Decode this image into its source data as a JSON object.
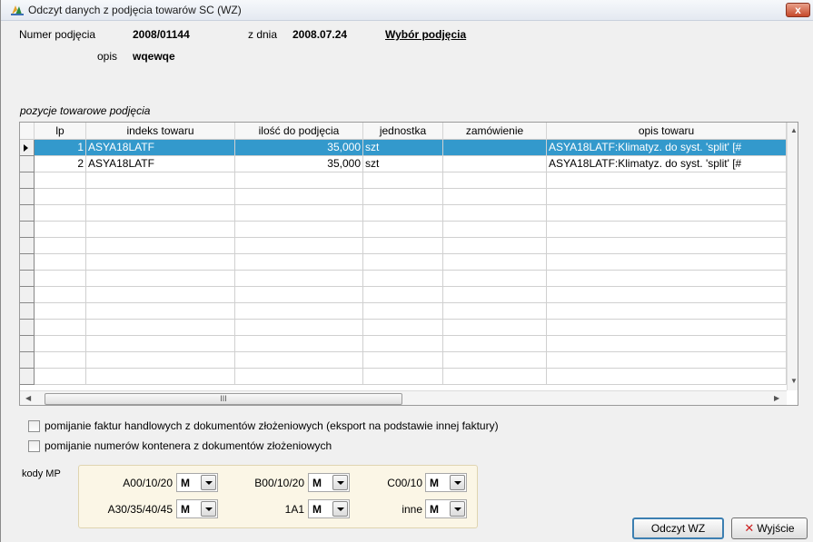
{
  "window": {
    "title": "Odczyt danych z podjęcia towarów SC (WZ)",
    "close_label": "x"
  },
  "header": {
    "numer_label": "Numer podjęcia",
    "numer_value": "2008/01144",
    "data_label": "z dnia",
    "data_value": "2008.07.24",
    "wybor_link": "Wybór podjęcia",
    "opis_label": "opis",
    "opis_value": "wqewqe"
  },
  "grid": {
    "section_label": "pozycje towarowe podjęcia",
    "columns": [
      "lp",
      "indeks towaru",
      "ilość do podjęcia",
      "jednostka",
      "zamówienie",
      "opis towaru"
    ],
    "rows": [
      {
        "lp": "1",
        "indeks": "ASYA18LATF",
        "ilosc": "35,000",
        "jednostka": "szt",
        "zamowienie": "",
        "opis": "ASYA18LATF:Klimatyz. do syst. 'split' [#"
      },
      {
        "lp": "2",
        "indeks": "ASYA18LATF",
        "ilosc": "35,000",
        "jednostka": "szt",
        "zamowienie": "",
        "opis": "ASYA18LATF:Klimatyz. do syst. 'split' [#"
      }
    ],
    "scroll_thumb_glyph": "III"
  },
  "options": {
    "checkbox1": "pomijanie faktur handlowych z dokumentów złożeniowych (eksport na podstawie innej faktury)",
    "checkbox2": "pomijanie numerów kontenera z dokumentów złożeniowych"
  },
  "kody": {
    "label": "kody MP",
    "fields": [
      {
        "label": "A00/10/20",
        "value": "M"
      },
      {
        "label": "B00/10/20",
        "value": "M"
      },
      {
        "label": "C00/10",
        "value": "M"
      },
      {
        "label": "A30/35/40/45",
        "value": "M"
      },
      {
        "label": "1A1",
        "value": "M"
      },
      {
        "label": "inne",
        "value": "M"
      }
    ]
  },
  "buttons": {
    "odczyt": "Odczyt WZ",
    "wyjscie": "Wyjście"
  }
}
